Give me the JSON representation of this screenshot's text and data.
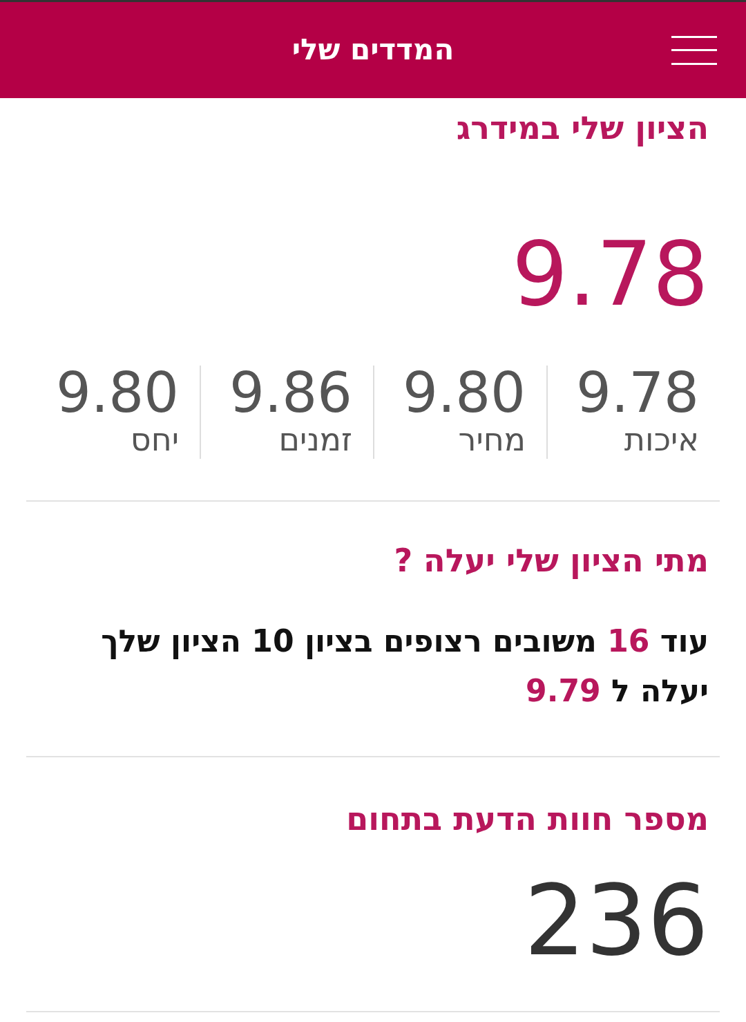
{
  "header": {
    "title": "המדדים שלי"
  },
  "rating": {
    "title": "הציון שלי במידרג",
    "score": "9.78",
    "metrics": [
      {
        "label": "איכות",
        "value": "9.78"
      },
      {
        "label": "מחיר",
        "value": "9.80"
      },
      {
        "label": "זמנים",
        "value": "9.86"
      },
      {
        "label": "יחס",
        "value": "9.80"
      }
    ]
  },
  "improvement": {
    "title": "מתי הציון שלי יעלה ?",
    "text": "עוד **16** משובים רצופים בציון 10 הציון שלך יעלה ל **9.79**"
  },
  "reviews": {
    "title": "מספר חוות הדעת בתחום",
    "count": "236"
  }
}
